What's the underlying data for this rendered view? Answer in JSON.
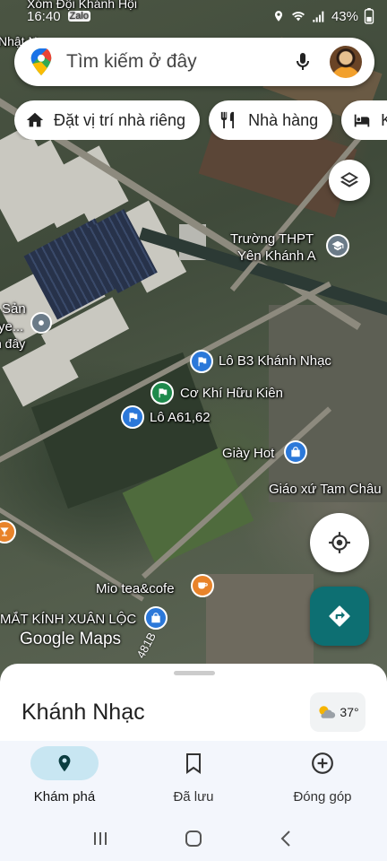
{
  "status_bar": {
    "time": "16:40",
    "battery": "43%"
  },
  "search": {
    "placeholder": "Tìm kiếm ở đây"
  },
  "chips": [
    {
      "label": "Đặt vị trí nhà riêng",
      "icon": "home-icon"
    },
    {
      "label": "Nhà hàng",
      "icon": "restaurant-icon"
    },
    {
      "label": "Kh",
      "icon": "hotel-icon"
    }
  ],
  "map": {
    "labels": {
      "top_street": "Xóm Đội Khánh Hội",
      "left_partial_top": "Nhật N",
      "school": "Trường THPT",
      "school_line2": "Yên Khánh A",
      "left_san": "Sản",
      "left_ye": "ye...",
      "left_day": "n đây",
      "lot_b3": "Lô B3 Khánh Nhạc",
      "co_khi": "Cơ Khí Hữu Kiên",
      "lot_a61": "Lô A61,62",
      "giay_hot": "Giày Hot",
      "church": "Giáo xứ Tam Châu",
      "mio": "Mio tea&cofe",
      "glasses": "MẮT KÍNH XUÂN LỘC",
      "road": "481B",
      "attribution": "Google Maps"
    }
  },
  "sheet": {
    "place_name": "Khánh Nhạc",
    "temperature": "37°"
  },
  "nav": {
    "items": [
      {
        "label": "Khám phá",
        "icon": "explore-pin-icon",
        "active": true
      },
      {
        "label": "Đã lưu",
        "icon": "bookmark-icon",
        "active": false
      },
      {
        "label": "Đóng góp",
        "icon": "add-circle-icon",
        "active": false
      }
    ]
  },
  "colors": {
    "accent": "#0d6f72",
    "pin_blue": "#2b78d9",
    "pin_green": "#1e8a4c",
    "pin_orange": "#e8832a",
    "nav_active": "#c8e6f2"
  }
}
